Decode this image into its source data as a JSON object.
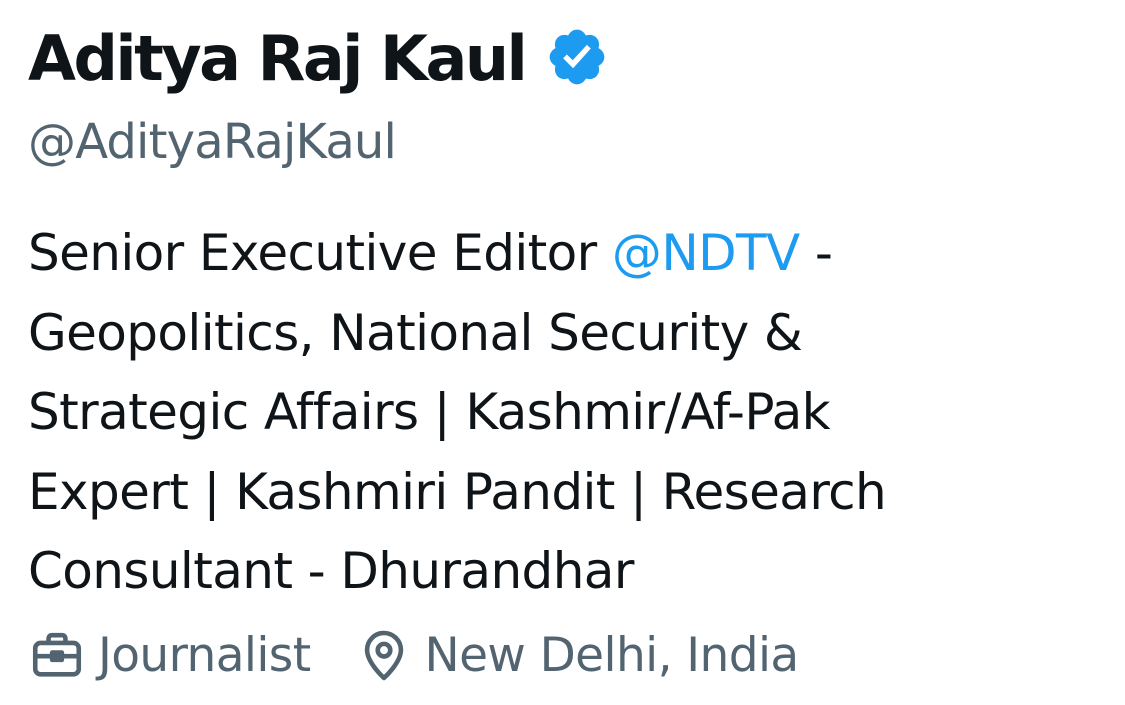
{
  "profile": {
    "display_name": "Aditya Raj Kaul",
    "verified_icon": "verified-badge-icon",
    "verified_color": "#1d9bf0",
    "handle": "@AdityaRajKaul",
    "bio": {
      "line1_prefix": "Senior Executive Editor ",
      "line1_mention": "@NDTV",
      "line1_suffix": " -",
      "line2": "Geopolitics, National Security &",
      "line3": "Strategic Affairs | Kashmir/Af-Pak",
      "line4": "Expert | Kashmiri Pandit | Research",
      "line5": "Consultant - Dhurandhar"
    },
    "meta": {
      "category_icon": "briefcase-icon",
      "category": "Journalist",
      "location_icon": "location-pin-icon",
      "location": "New Delhi, India"
    },
    "colors": {
      "text_primary": "#0f1419",
      "text_secondary": "#536471",
      "link": "#1d9bf0"
    }
  }
}
